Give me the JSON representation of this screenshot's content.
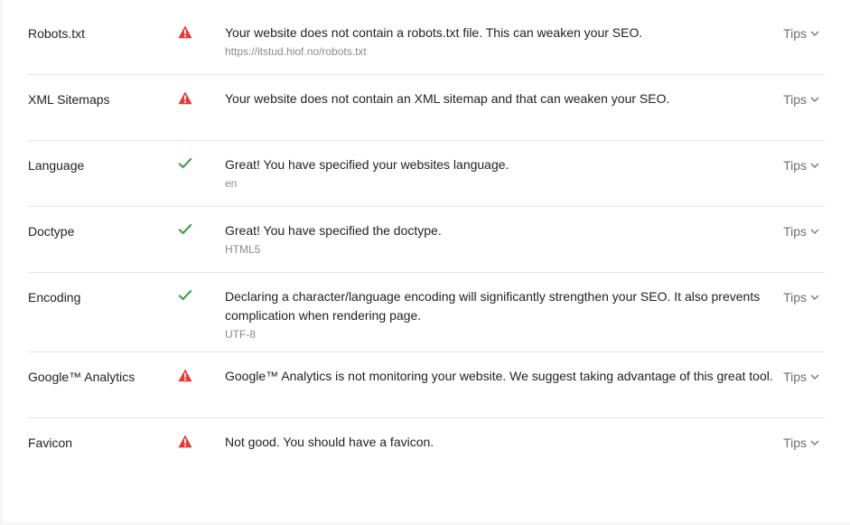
{
  "tips_label": "Tips",
  "colors": {
    "warning": "#e53935",
    "success": "#43a047",
    "text": "#222222",
    "muted": "#8a8a8a"
  },
  "rows": [
    {
      "label": "Robots.txt",
      "status": "warning",
      "status_icon": "warning-triangle-icon",
      "message": "Your website does not contain a robots.txt file. This can weaken your SEO.",
      "detail": "https://itstud.hiof.no/robots.txt"
    },
    {
      "label": "XML Sitemaps",
      "status": "warning",
      "status_icon": "warning-triangle-icon",
      "message": "Your website does not contain an XML sitemap and that can weaken your SEO.",
      "detail": ""
    },
    {
      "label": "Language",
      "status": "success",
      "status_icon": "checkmark-icon",
      "message": "Great! You have specified your websites language.",
      "detail": "en"
    },
    {
      "label": "Doctype",
      "status": "success",
      "status_icon": "checkmark-icon",
      "message": "Great! You have specified the doctype.",
      "detail": "HTML5"
    },
    {
      "label": "Encoding",
      "status": "success",
      "status_icon": "checkmark-icon",
      "message": "Declaring a character/language encoding will significantly strengthen your SEO. It also prevents complication when rendering page.",
      "detail": "UTF-8"
    },
    {
      "label": "Google™ Analytics",
      "status": "warning",
      "status_icon": "warning-triangle-icon",
      "message": "Google™ Analytics is not monitoring your website. We suggest taking advantage of this great tool.",
      "detail": ""
    },
    {
      "label": "Favicon",
      "status": "warning",
      "status_icon": "warning-triangle-icon",
      "message": "Not good. You should have a favicon.",
      "detail": ""
    }
  ]
}
